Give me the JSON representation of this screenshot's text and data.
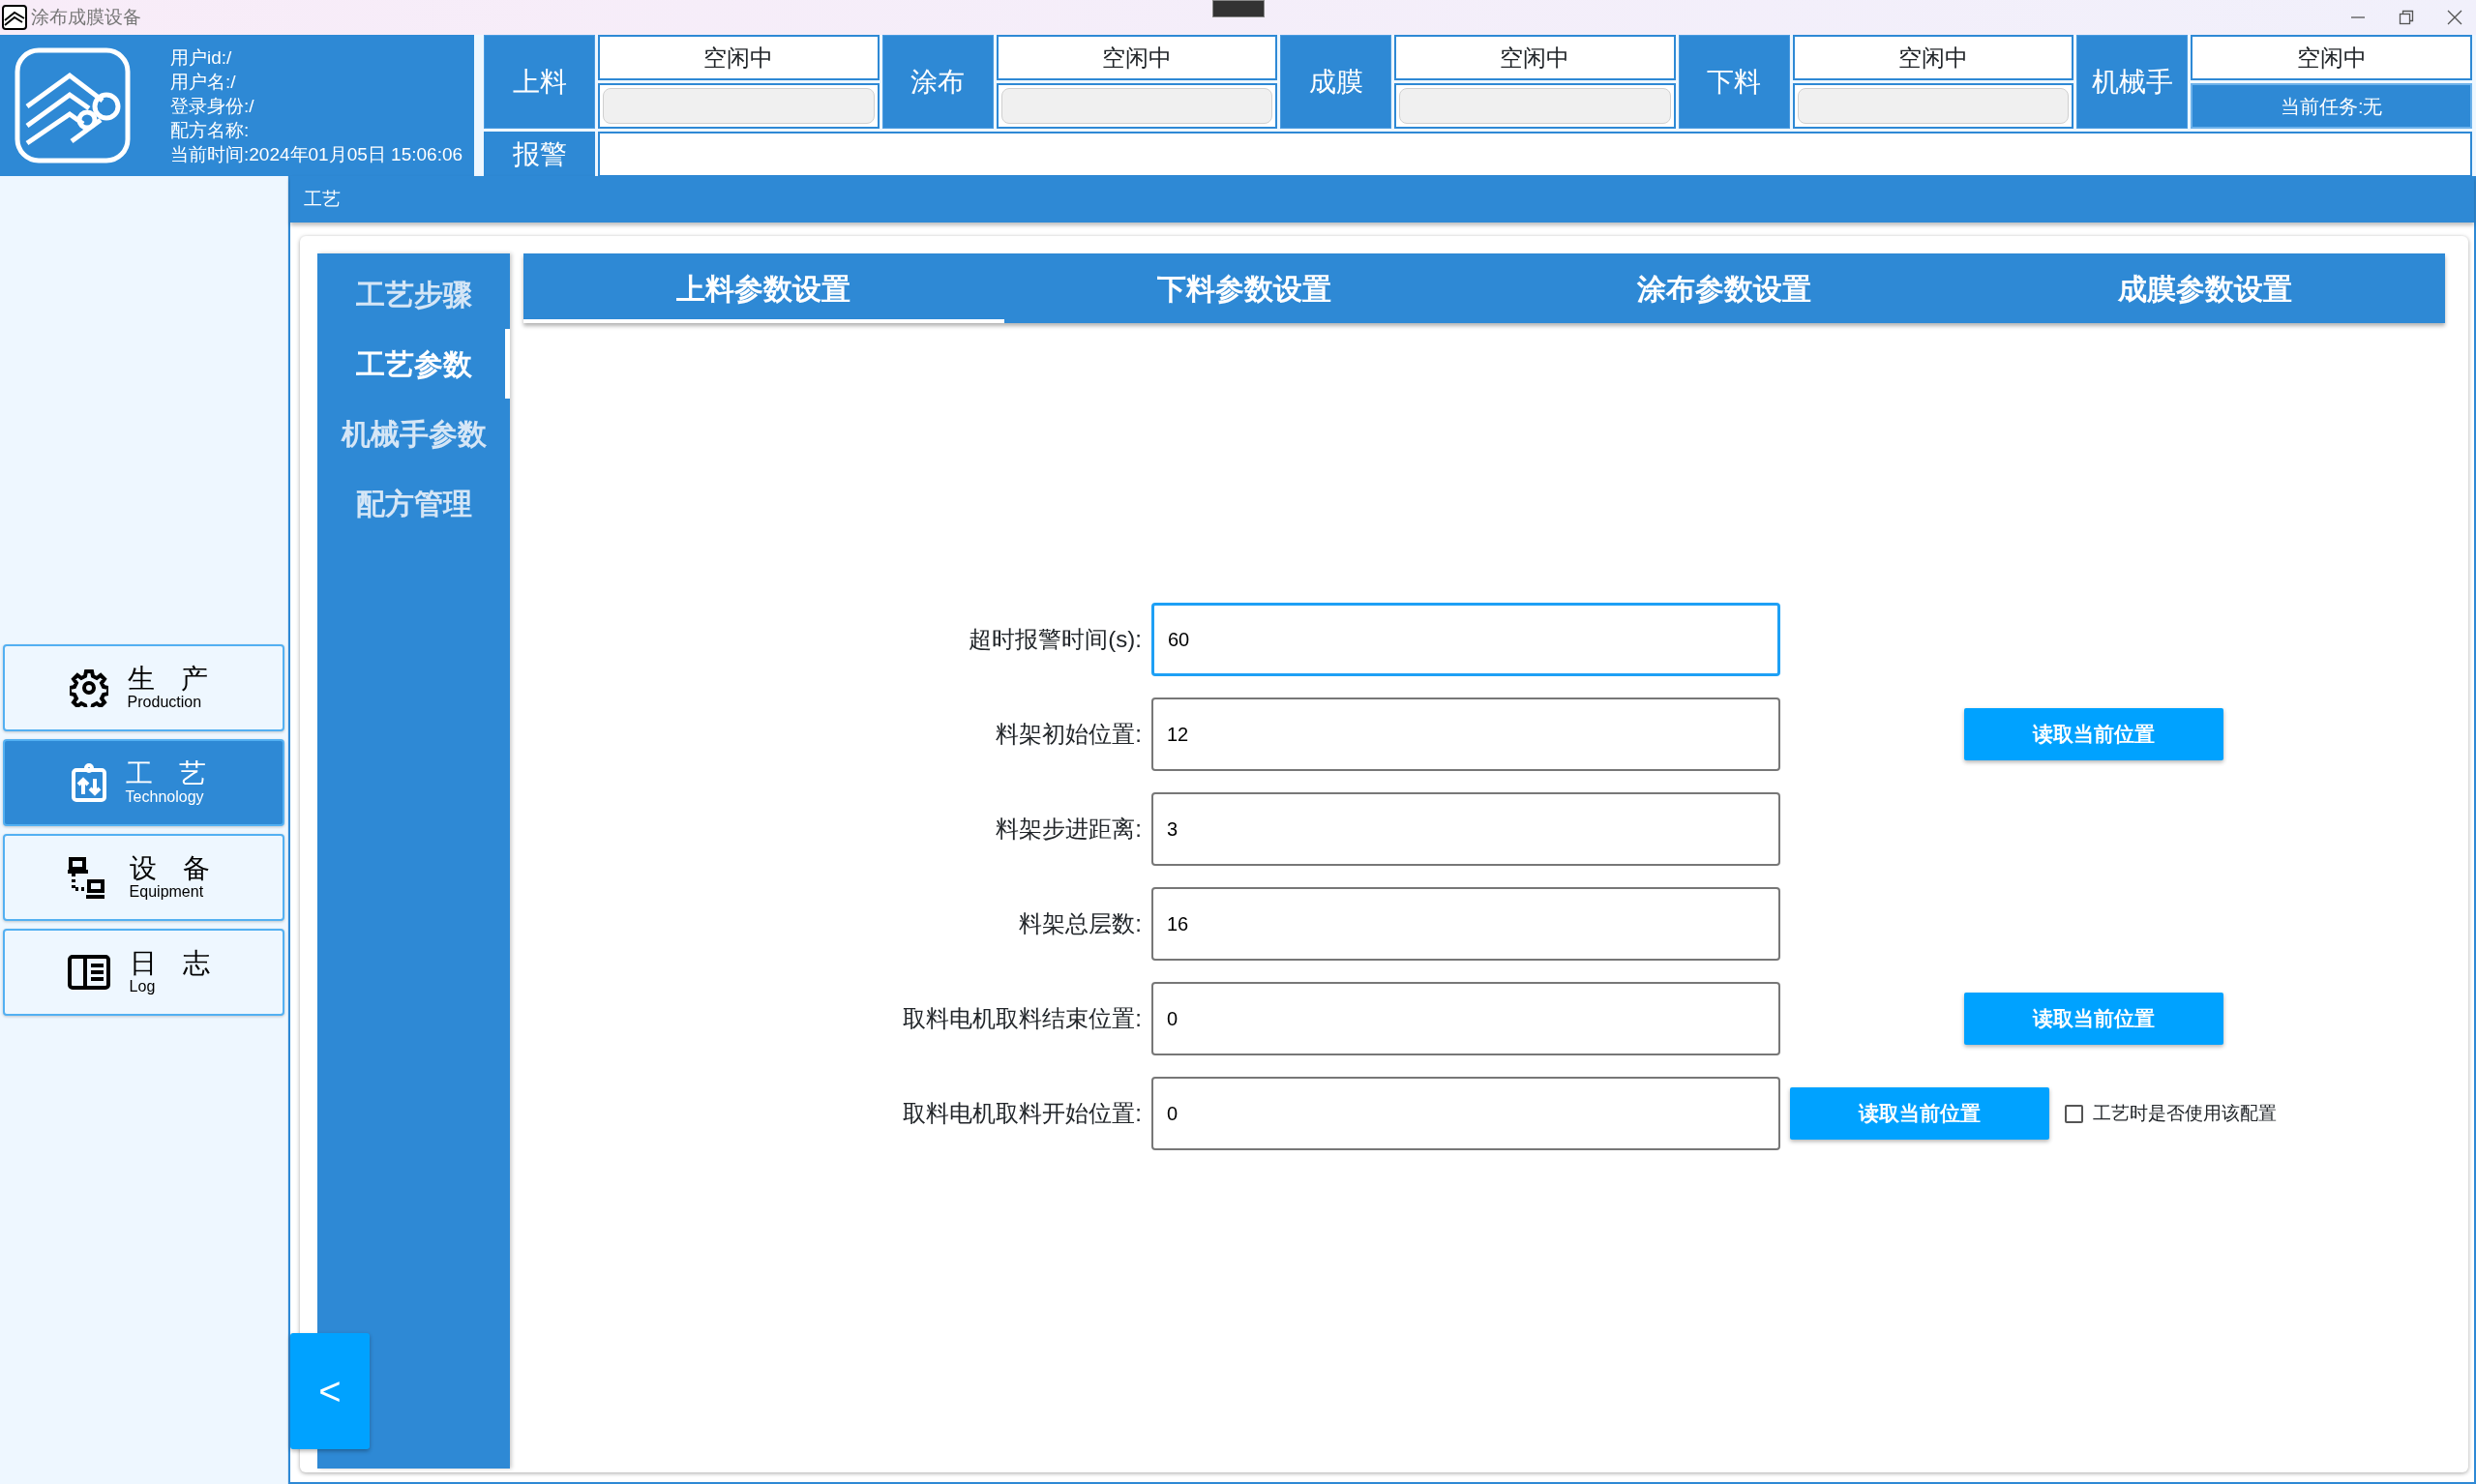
{
  "window": {
    "title": "涂布成膜设备"
  },
  "user_info": [
    "用户id:/",
    "用户名:/",
    "登录身份:/",
    "配方名称:",
    "当前时间:2024年01月05日 15:06:06"
  ],
  "stations": [
    {
      "name": "上料",
      "status": "空闲中",
      "kind": "progress",
      "level": 0
    },
    {
      "name": "涂布",
      "status": "空闲中",
      "kind": "progress",
      "level": 0
    },
    {
      "name": "成膜",
      "status": "空闲中",
      "kind": "progress",
      "level": 0
    },
    {
      "name": "下料",
      "status": "空闲中",
      "kind": "progress",
      "level": 0
    },
    {
      "name": "机械手",
      "status": "空闲中",
      "kind": "task",
      "task": "当前任务:无"
    }
  ],
  "alarm": {
    "label": "报警"
  },
  "nav": [
    {
      "title": "生 产",
      "subtitle": "Production",
      "selected": false
    },
    {
      "title": "工 艺",
      "subtitle": "Technology",
      "selected": true
    },
    {
      "title": "设 备",
      "subtitle": "Equipment",
      "selected": false
    },
    {
      "title": "日 志",
      "subtitle": "Log",
      "selected": false
    }
  ],
  "page_title": "工艺",
  "sub_nav": [
    {
      "label": "工艺步骤",
      "selected": false
    },
    {
      "label": "工艺参数",
      "selected": true
    },
    {
      "label": "机械手参数",
      "selected": false
    },
    {
      "label": "配方管理",
      "selected": false
    }
  ],
  "tabs": [
    {
      "label": "上料参数设置",
      "selected": true
    },
    {
      "label": "下料参数设置",
      "selected": false
    },
    {
      "label": "涂布参数设置",
      "selected": false
    },
    {
      "label": "成膜参数设置",
      "selected": false
    }
  ],
  "fields": [
    {
      "kind": "plain",
      "label": "超时报警时间(s):",
      "value": "60",
      "focused": true
    },
    {
      "kind": "far",
      "label": "料架初始位置:",
      "value": "12",
      "focused": false,
      "button": "读取当前位置"
    },
    {
      "kind": "plain",
      "label": "料架步进距离:",
      "value": "3",
      "focused": false
    },
    {
      "kind": "plain",
      "label": "料架总层数:",
      "value": "16",
      "focused": false
    },
    {
      "kind": "far",
      "label": "取料电机取料结束位置:",
      "value": "0",
      "focused": false,
      "button": "读取当前位置"
    },
    {
      "kind": "near",
      "label": "取料电机取料开始位置:",
      "value": "0",
      "focused": false,
      "button": "读取当前位置",
      "checkbox": {
        "label": "工艺时是否使用该配置",
        "checked": false
      }
    }
  ],
  "collapse_button": "<"
}
